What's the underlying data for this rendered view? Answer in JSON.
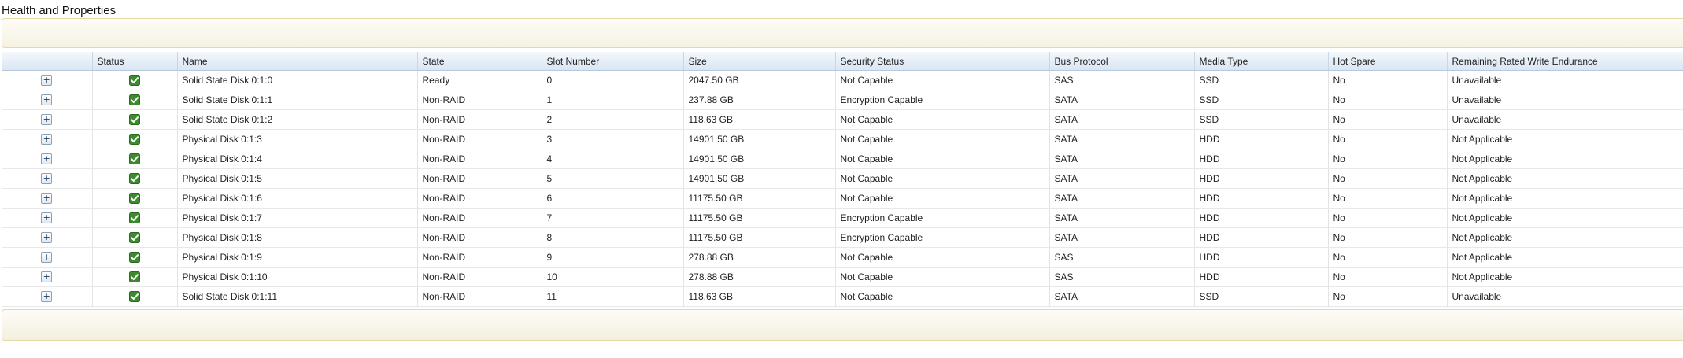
{
  "page": {
    "title": "Health and Properties"
  },
  "table": {
    "columns": [
      "Status",
      "Name",
      "State",
      "Slot Number",
      "Size",
      "Security Status",
      "Bus Protocol",
      "Media Type",
      "Hot Spare",
      "Remaining Rated Write Endurance"
    ],
    "expand_symbol": "+",
    "rows": [
      {
        "name": "Solid State Disk 0:1:0",
        "state": "Ready",
        "slot": "0",
        "size": "2047.50 GB",
        "security": "Not Capable",
        "bus": "SAS",
        "media": "SSD",
        "hotspare": "No",
        "endurance": "Unavailable"
      },
      {
        "name": "Solid State Disk 0:1:1",
        "state": "Non-RAID",
        "slot": "1",
        "size": "237.88 GB",
        "security": "Encryption Capable",
        "bus": "SATA",
        "media": "SSD",
        "hotspare": "No",
        "endurance": "Unavailable"
      },
      {
        "name": "Solid State Disk 0:1:2",
        "state": "Non-RAID",
        "slot": "2",
        "size": "118.63 GB",
        "security": "Not Capable",
        "bus": "SATA",
        "media": "SSD",
        "hotspare": "No",
        "endurance": "Unavailable"
      },
      {
        "name": "Physical Disk 0:1:3",
        "state": "Non-RAID",
        "slot": "3",
        "size": "14901.50 GB",
        "security": "Not Capable",
        "bus": "SATA",
        "media": "HDD",
        "hotspare": "No",
        "endurance": "Not Applicable"
      },
      {
        "name": "Physical Disk 0:1:4",
        "state": "Non-RAID",
        "slot": "4",
        "size": "14901.50 GB",
        "security": "Not Capable",
        "bus": "SATA",
        "media": "HDD",
        "hotspare": "No",
        "endurance": "Not Applicable"
      },
      {
        "name": "Physical Disk 0:1:5",
        "state": "Non-RAID",
        "slot": "5",
        "size": "14901.50 GB",
        "security": "Not Capable",
        "bus": "SATA",
        "media": "HDD",
        "hotspare": "No",
        "endurance": "Not Applicable"
      },
      {
        "name": "Physical Disk 0:1:6",
        "state": "Non-RAID",
        "slot": "6",
        "size": "11175.50 GB",
        "security": "Not Capable",
        "bus": "SATA",
        "media": "HDD",
        "hotspare": "No",
        "endurance": "Not Applicable"
      },
      {
        "name": "Physical Disk 0:1:7",
        "state": "Non-RAID",
        "slot": "7",
        "size": "11175.50 GB",
        "security": "Encryption Capable",
        "bus": "SATA",
        "media": "HDD",
        "hotspare": "No",
        "endurance": "Not Applicable"
      },
      {
        "name": "Physical Disk 0:1:8",
        "state": "Non-RAID",
        "slot": "8",
        "size": "11175.50 GB",
        "security": "Encryption Capable",
        "bus": "SATA",
        "media": "HDD",
        "hotspare": "No",
        "endurance": "Not Applicable"
      },
      {
        "name": "Physical Disk 0:1:9",
        "state": "Non-RAID",
        "slot": "9",
        "size": "278.88 GB",
        "security": "Not Capable",
        "bus": "SAS",
        "media": "HDD",
        "hotspare": "No",
        "endurance": "Not Applicable"
      },
      {
        "name": "Physical Disk 0:1:10",
        "state": "Non-RAID",
        "slot": "10",
        "size": "278.88 GB",
        "security": "Not Capable",
        "bus": "SAS",
        "media": "HDD",
        "hotspare": "No",
        "endurance": "Not Applicable"
      },
      {
        "name": "Solid State Disk 0:1:11",
        "state": "Non-RAID",
        "slot": "11",
        "size": "118.63 GB",
        "security": "Not Capable",
        "bus": "SATA",
        "media": "SSD",
        "hotspare": "No",
        "endurance": "Unavailable"
      }
    ]
  },
  "icons": {
    "status": "status-ok-check-icon",
    "expand": "expand-plus-icon"
  },
  "colors": {
    "status_ok": "#3e8a2e",
    "header_gradient_end": "#d9e6f3",
    "panel_border": "#e6d9a8"
  }
}
